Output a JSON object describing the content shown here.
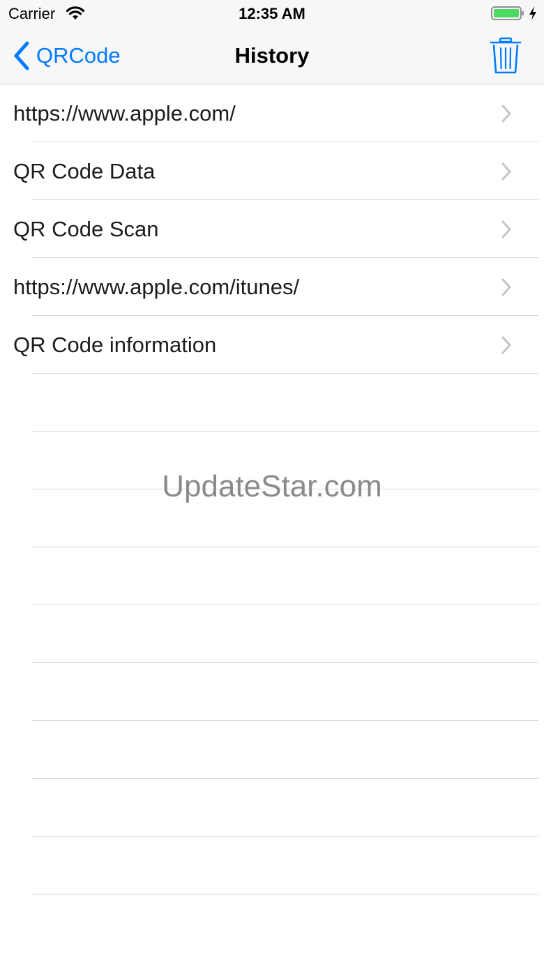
{
  "status_bar": {
    "carrier": "Carrier",
    "time": "12:35 AM",
    "wifi_icon": "wifi-icon",
    "battery_icon": "battery-icon",
    "charging_icon": "bolt-icon",
    "battery_color": "#4cd964"
  },
  "nav": {
    "back_label": "QRCode",
    "title": "History",
    "trash_icon": "trash-icon",
    "accent_color": "#007aff"
  },
  "history": {
    "items": [
      {
        "label": "https://www.apple.com/"
      },
      {
        "label": "QR Code Data"
      },
      {
        "label": "QR Code Scan"
      },
      {
        "label": "https://www.apple.com/itunes/"
      },
      {
        "label": "QR Code information"
      }
    ]
  },
  "watermark": "UpdateStar.com"
}
